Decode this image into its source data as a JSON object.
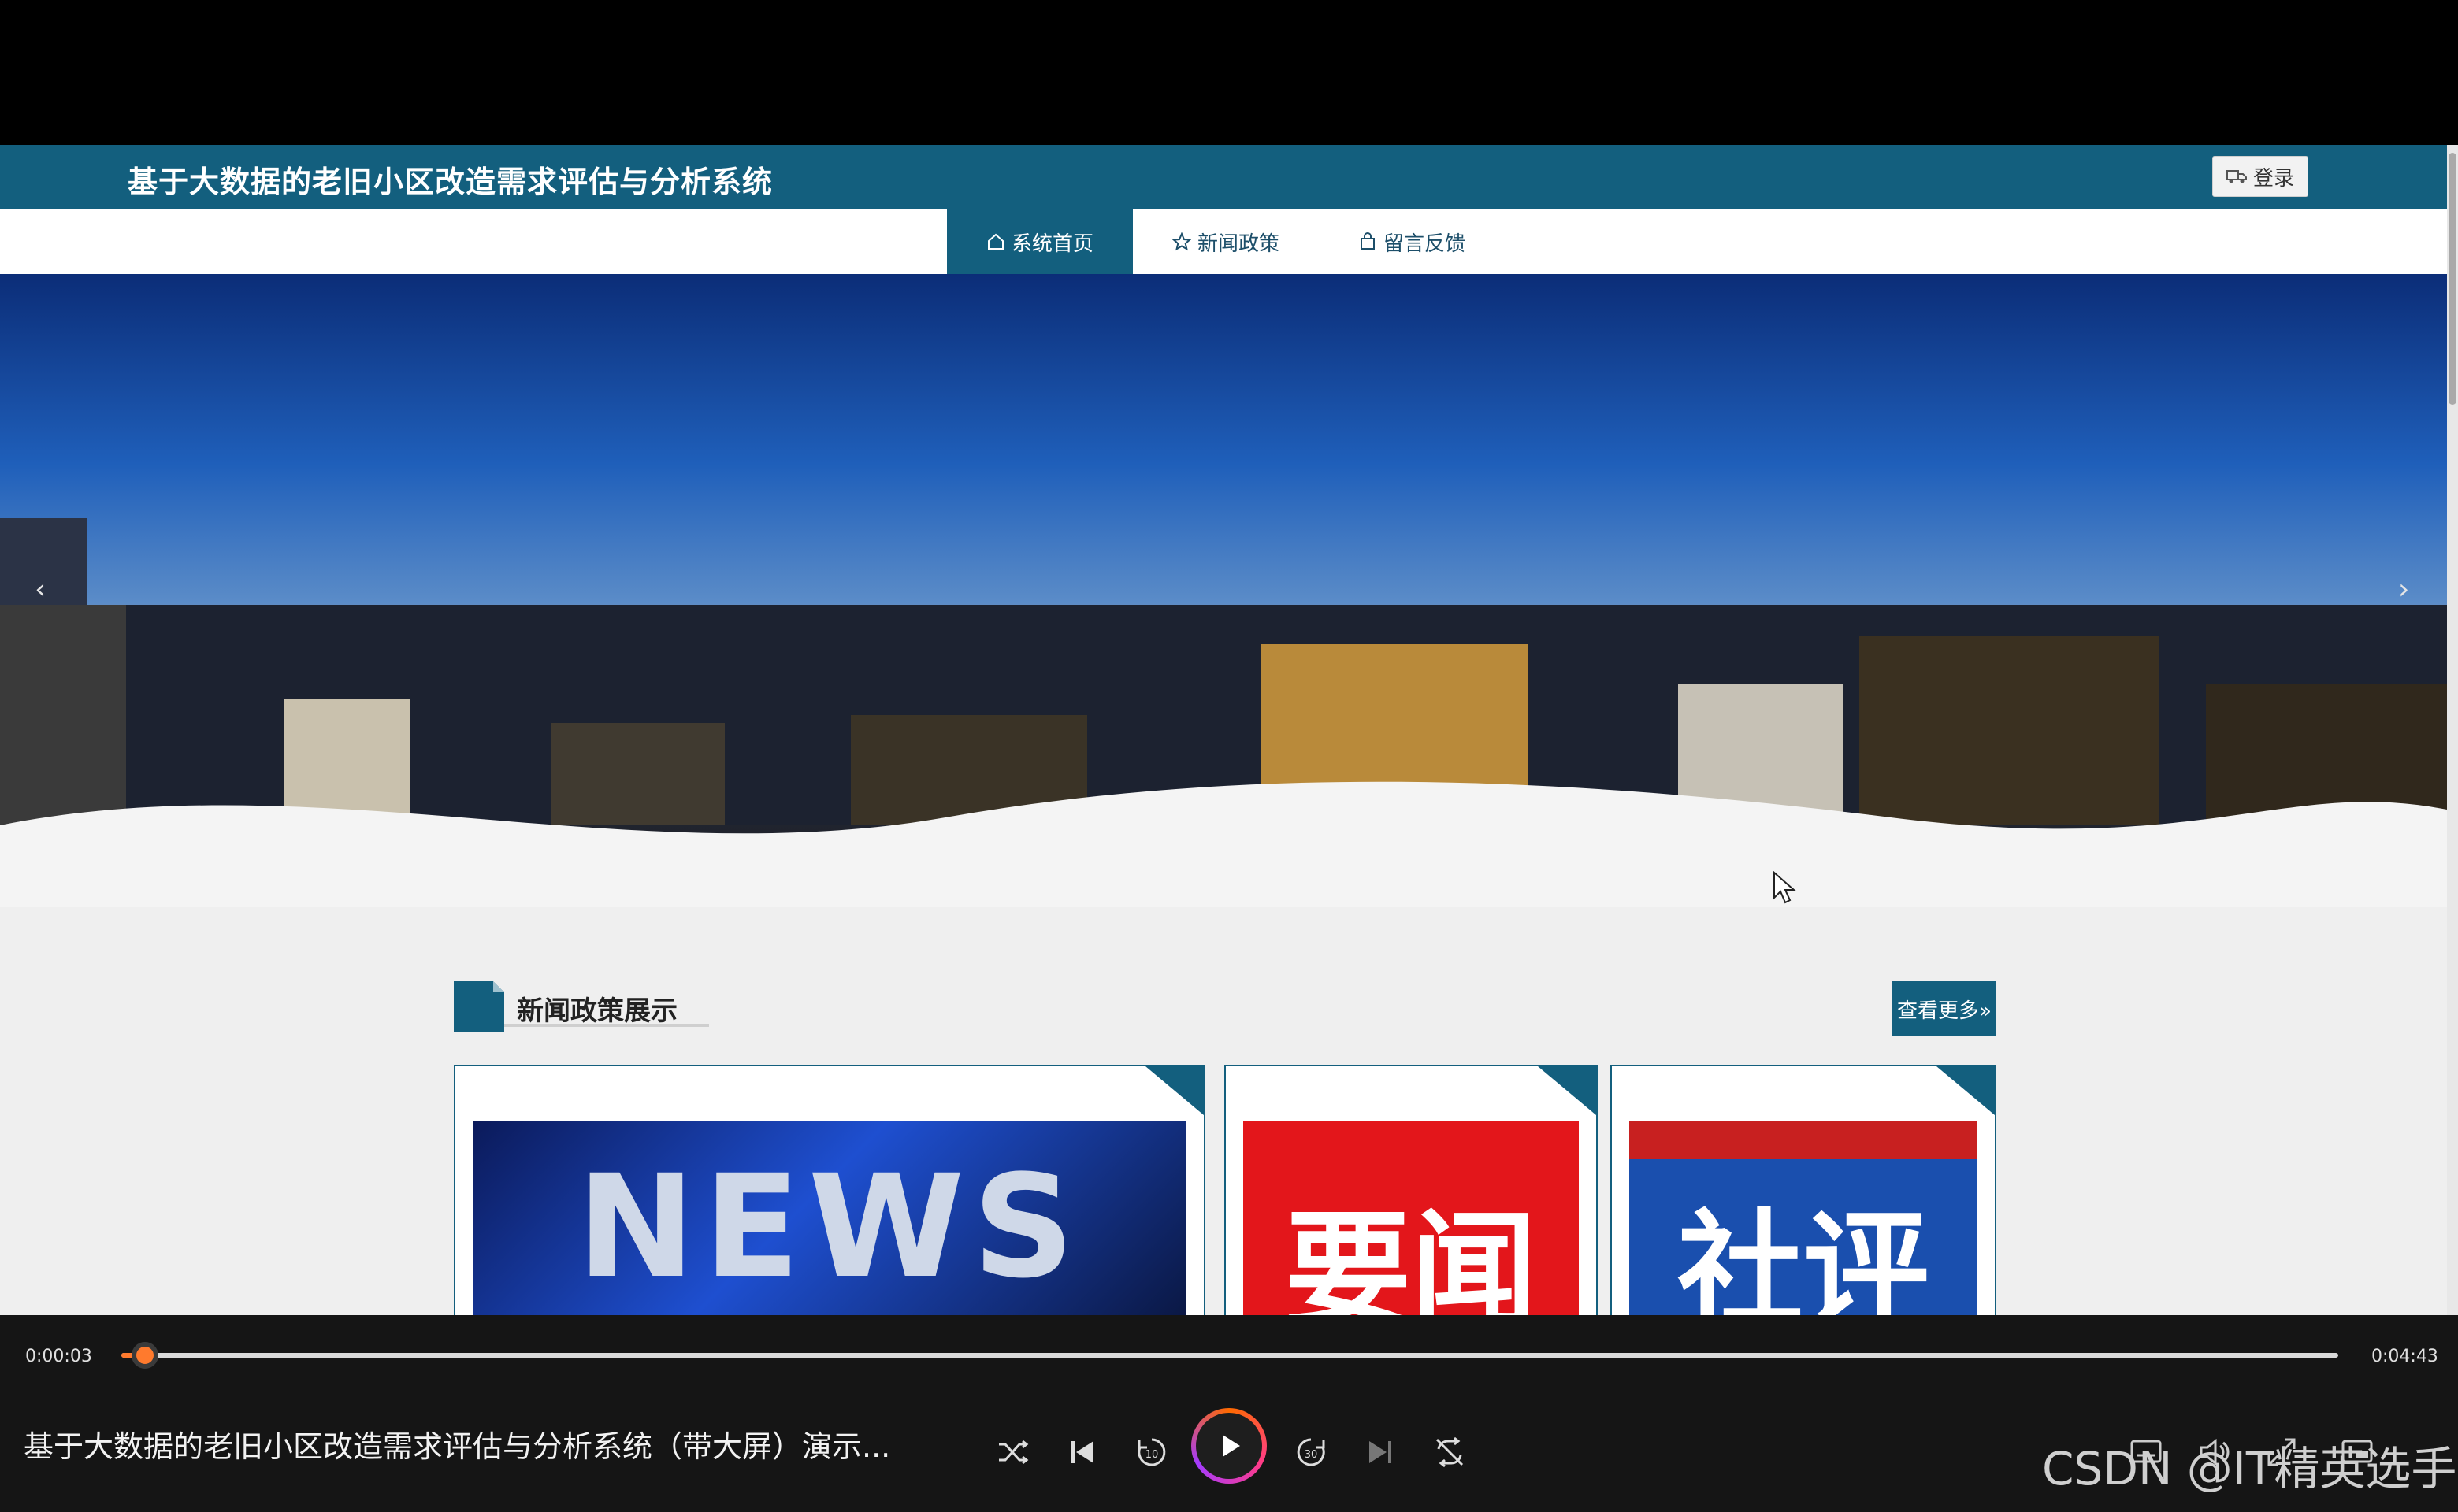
{
  "site": {
    "title": "基于大数据的老旧小区改造需求评估与分析系统",
    "login_label": "登录"
  },
  "nav": [
    {
      "label": "系统首页",
      "icon": "home-icon",
      "active": true
    },
    {
      "label": "新闻政策",
      "icon": "star-icon",
      "active": false
    },
    {
      "label": "留言反馈",
      "icon": "bag-icon",
      "active": false
    }
  ],
  "banner": {
    "prev_arrow": "‹",
    "next_arrow": "›"
  },
  "news_section": {
    "title": "新闻政策展示",
    "more_label": "查看更多»"
  },
  "cards": [
    {
      "image_text": "NEWS"
    },
    {
      "image_text": "要闻"
    },
    {
      "image_text": "社评"
    }
  ],
  "player": {
    "current_time": "0:00:03",
    "total_time": "0:04:43",
    "progress_fraction": 0.0106,
    "video_title": "基于大数据的老旧小区改造需求评估与分析系统（带大屏）演示...",
    "watermark": "CSDN @IT精英选手"
  },
  "colors": {
    "brand": "#135f7e",
    "progress": "#ff7a2d"
  }
}
